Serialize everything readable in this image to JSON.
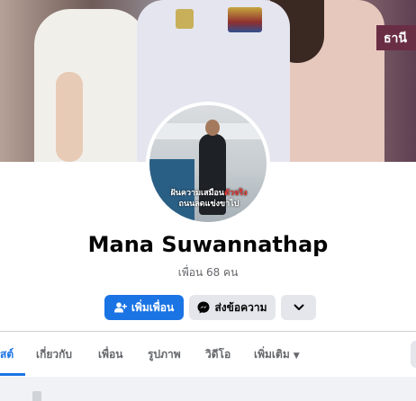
{
  "cover": {
    "sign_text": "ธานี"
  },
  "avatar": {
    "caption_line1": "ฝันความเสมือน",
    "caption_highlight": "ตัวจริง",
    "caption_line2": "ถนนลดแข่งขาไป"
  },
  "profile": {
    "name": "Mana Suwannathap",
    "friend_count": "เพื่อน 68 คน"
  },
  "actions": {
    "add_friend_label": "เพิ่มเพื่อน",
    "message_label": "ส่งข้อความ"
  },
  "tabs": [
    {
      "label": "สต์",
      "active": true
    },
    {
      "label": "เกี่ยวกับ"
    },
    {
      "label": "เพื่อน"
    },
    {
      "label": "รูปภาพ"
    },
    {
      "label": "วิดีโอ"
    },
    {
      "label": "เพิ่มเติม"
    }
  ],
  "colors": {
    "accent": "#1b74e4",
    "button_secondary": "#e4e6eb",
    "text_primary": "#050505",
    "text_secondary": "#65676b"
  },
  "icons": {
    "add_friend": "add-person-icon",
    "message": "messenger-icon",
    "more": "chevron-down-icon",
    "tab_more": "caret-down-icon"
  }
}
